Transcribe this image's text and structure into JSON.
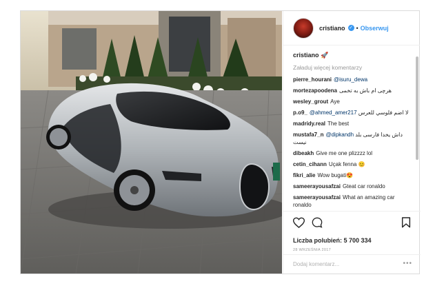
{
  "header": {
    "username": "cristiano",
    "separator": "•",
    "follow_label": "Obserwuj"
  },
  "caption": {
    "username": "cristiano",
    "text": "🚀"
  },
  "load_more_label": "Załaduj więcej komentarzy",
  "comments": [
    {
      "user": "pierre_hourani",
      "mention": "@isuru_dewa",
      "text": ""
    },
    {
      "user": "mortezapoodena",
      "mention": "",
      "text": "هرچی ام باش به تخمی"
    },
    {
      "user": "wesley_grout",
      "mention": "",
      "text": "Aye"
    },
    {
      "user": "p.o9_",
      "mention": "@ahmed_amer217",
      "text": "لا اضم فلوسي للعرس"
    },
    {
      "user": "madridy.real",
      "mention": "",
      "text": "The best"
    },
    {
      "user": "mustafa7_n",
      "mention": "@dipkandh",
      "text": "داش یخدا فارسی بلد نیست"
    },
    {
      "user": "dibeakh",
      "mention": "",
      "text": "Give me one plizzzz lol"
    },
    {
      "user": "cetin_cihann",
      "mention": "",
      "text": "Uçak fenna 😊"
    },
    {
      "user": "fikri_alie",
      "mention": "",
      "text": "Wow bugati😍"
    },
    {
      "user": "sameerayousafzai",
      "mention": "",
      "text": "Gteat car ronaldo"
    },
    {
      "user": "sameerayousafzai",
      "mention": "",
      "text": "What an amazing car ronaldo"
    }
  ],
  "likes_label": "Liczba polubień:",
  "likes_count": "5 700 334",
  "date": "28 września 2017",
  "add_comment_placeholder": "Dodaj komentarz...",
  "more_options": "•••",
  "icons": {
    "like": "heart-icon",
    "comment": "comment-icon",
    "save": "bookmark-icon",
    "verified": "verified-badge-icon",
    "caption_emoji": "rocket-icon"
  },
  "colors": {
    "link": "#3897f0",
    "mention": "#003569",
    "muted": "#999999",
    "border": "#dbdbdb"
  }
}
